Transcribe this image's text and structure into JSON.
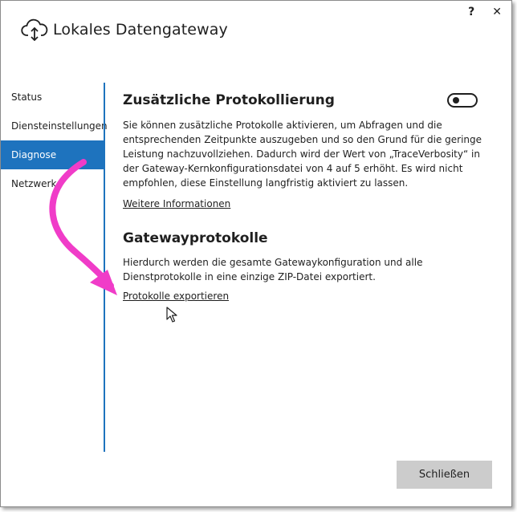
{
  "window": {
    "title": "Lokales Datengateway",
    "help_label": "?",
    "close_label": "✕"
  },
  "sidebar": {
    "items": [
      {
        "label": "Status"
      },
      {
        "label": "Diensteinstellungen"
      },
      {
        "label": "Diagnose",
        "active": true
      },
      {
        "label": "Netzwerk"
      }
    ]
  },
  "logging": {
    "title": "Zusätzliche Protokollierung",
    "description": "Sie können zusätzliche Protokolle aktivieren, um Abfragen und die entsprechenden Zeitpunkte auszugeben und so den Grund für die geringe Leistung nachzuvollziehen. Dadurch wird der Wert von „TraceVerbosity“ in der Gateway-Kernkonfigurationsdatei von 4 auf 5 erhöht. Es wird nicht empfohlen, diese Einstellung langfristig aktiviert zu lassen.",
    "link": "Weitere Informationen",
    "toggle_on": false
  },
  "gateway_logs": {
    "title": "Gatewayprotokolle",
    "description": "Hierdurch werden die gesamte Gatewaykonfiguration und alle Dienstprotokolle in eine einzige ZIP-Datei exportiert.",
    "link": "Protokolle exportieren"
  },
  "footer": {
    "close_button": "Schließen"
  },
  "colors": {
    "accent": "#1e73be",
    "annotation_arrow": "#f03cc8",
    "button_bg": "#cccccc"
  }
}
